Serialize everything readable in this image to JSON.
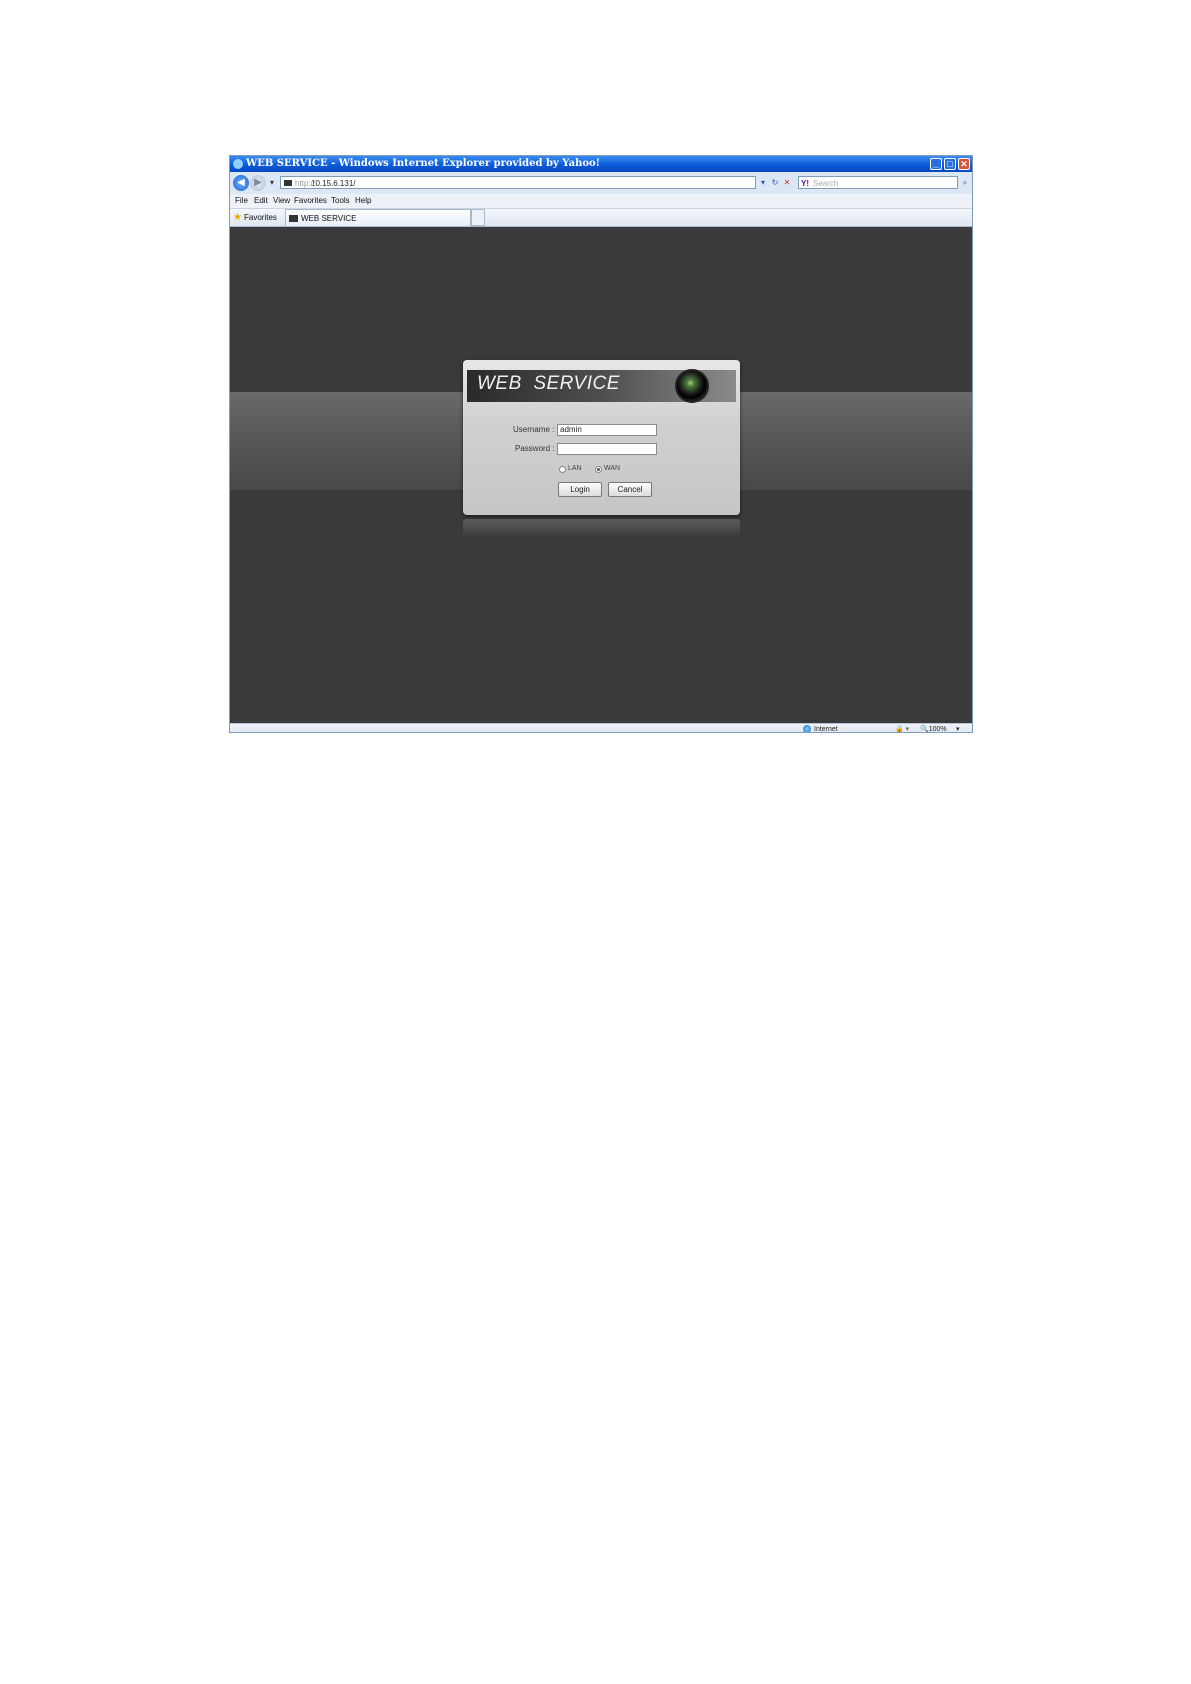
{
  "window": {
    "title": "WEB SERVICE - Windows Internet Explorer provided by Yahoo!",
    "minimize": "_",
    "maximize": "□",
    "close": "✕"
  },
  "address_bar": {
    "back": "◀",
    "forward": "▶",
    "dropdown": "▾",
    "scheme": "http://",
    "url": "10.15.6.131/",
    "go": "▾",
    "refresh": "↻",
    "stop": "✕",
    "search_brand": "Y!",
    "search_placeholder": "Search",
    "search_go": "⌕"
  },
  "menu": {
    "items": [
      "File",
      "Edit",
      "View",
      "Favorites",
      "Tools",
      "Help"
    ]
  },
  "favorites_bar": {
    "favorites_label": "Favorites",
    "star": "★",
    "tab_title": "WEB SERVICE"
  },
  "login": {
    "title": "WEB  SERVICE",
    "username_label": "Username :",
    "username_value": "admin",
    "password_label": "Password :",
    "password_value": "",
    "network_options": [
      "LAN",
      "WAN"
    ],
    "selected_option": "WAN",
    "login_button": "Login",
    "cancel_button": "Cancel"
  },
  "status_bar": {
    "zone": "Internet",
    "protected": "🔒 ▾",
    "zoom": "🔍100%",
    "zoom_dropdown": "▾"
  },
  "colors": {
    "content_background": "#3a3a3a",
    "titlebar": "#0a58d8",
    "dialog": "#d0d0d0"
  }
}
